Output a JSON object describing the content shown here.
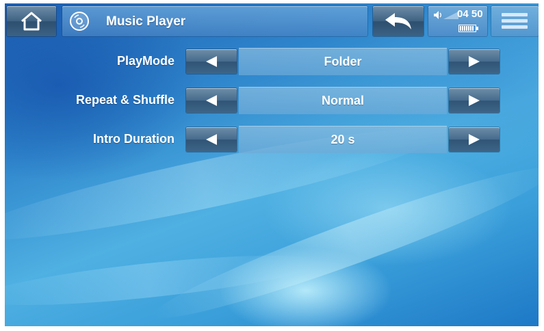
{
  "header": {
    "title": "Music Player",
    "home_icon": "home-icon",
    "app_icon": "cd-icon",
    "back_icon": "back-arrow-icon",
    "menu_icon": "menu-icon"
  },
  "status": {
    "time": "04 50",
    "volume_icon": "volume-icon",
    "battery_icon": "battery-icon"
  },
  "settings": [
    {
      "label": "PlayMode",
      "value": "Folder"
    },
    {
      "label": "Repeat & Shuffle",
      "value": "Normal"
    },
    {
      "label": "Intro Duration",
      "value": "20 s"
    }
  ],
  "colors": {
    "accent": "#2f86cc",
    "button": "#3f6283",
    "text": "#ffffff"
  }
}
